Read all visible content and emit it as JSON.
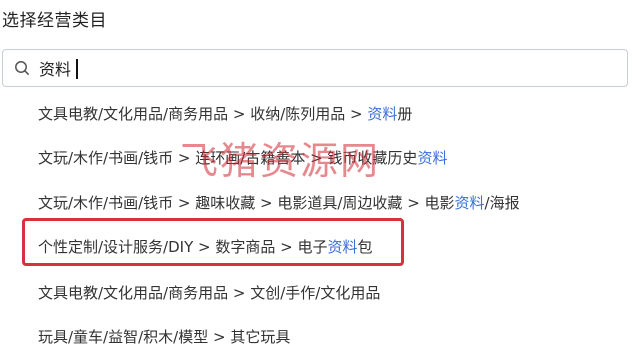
{
  "title": "选择经营类目",
  "search": {
    "value": "资料",
    "placeholder": ""
  },
  "results": [
    {
      "pre": "文具电教/文化用品/商务用品 > 收纳/陈列用品 > ",
      "hl": "资料",
      "post": "册"
    },
    {
      "pre": "文玩/木作/书画/钱币 > 连环画/古籍善本 > 钱币收藏历史",
      "hl": "资料",
      "post": ""
    },
    {
      "pre": "文玩/木作/书画/钱币 > 趣味收藏 > 电影道具/周边收藏 > 电影",
      "hl": "资料",
      "post": "/海报"
    },
    {
      "pre": "个性定制/设计服务/DIY > 数字商品 > 电子",
      "hl": "资料",
      "post": "包"
    },
    {
      "pre": "文具电教/文化用品/商务用品 > 文创/手作/文化用品",
      "hl": "",
      "post": ""
    },
    {
      "pre": "玩具/童车/益智/积木/模型 > 其它玩具",
      "hl": "",
      "post": ""
    }
  ],
  "watermark": "飞猪资源网",
  "colors": {
    "highlight_text": "#3d6fd8",
    "frame": "#d7303f",
    "watermark": "#d12a34"
  }
}
